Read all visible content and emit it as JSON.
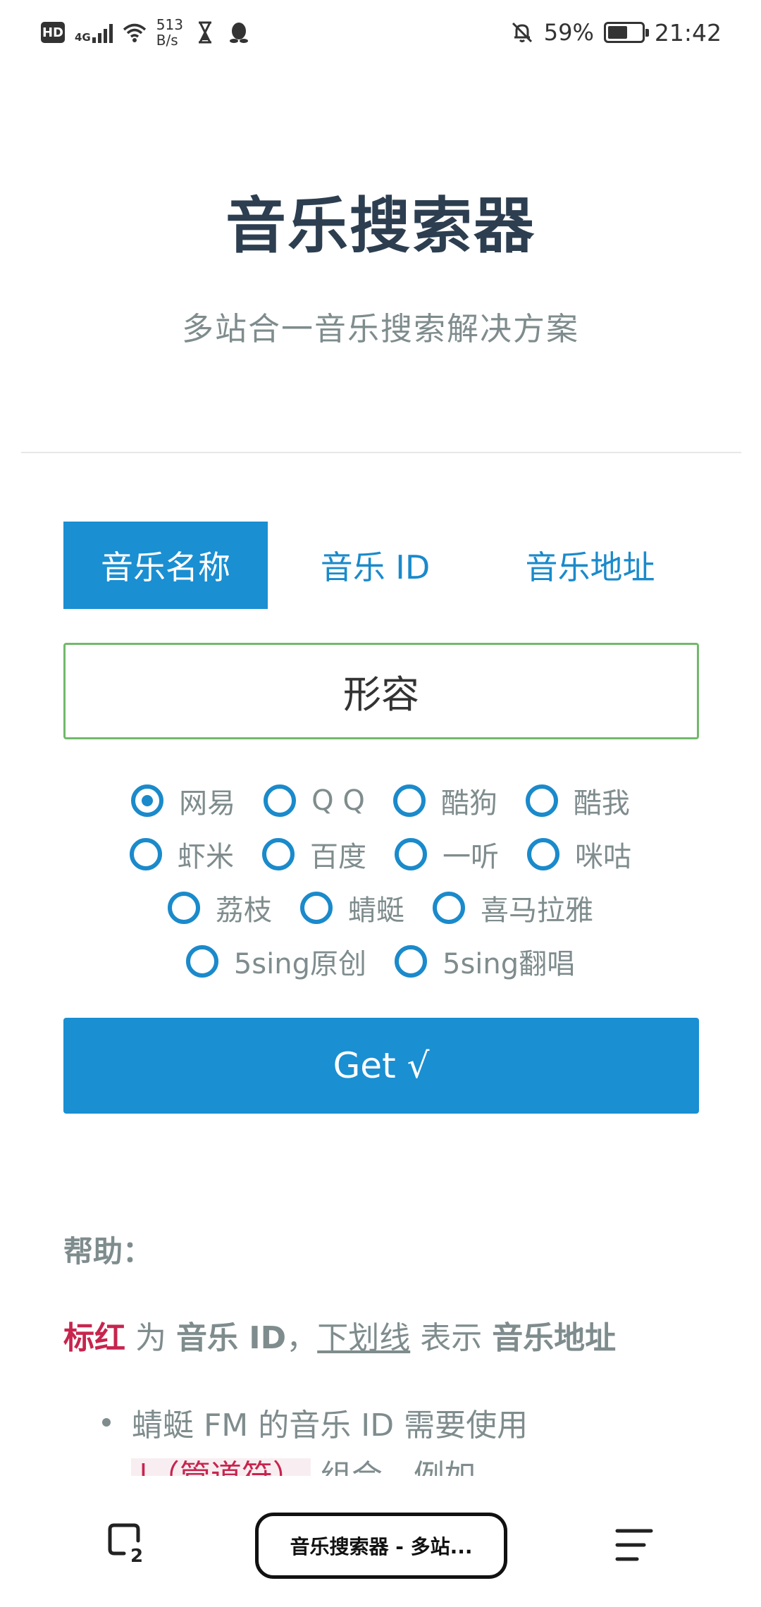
{
  "status_bar": {
    "hd_label": "HD",
    "network_label": "4G",
    "speed_value": "513",
    "speed_unit": "B/s",
    "battery_percent": "59%",
    "battery_level": 0.59,
    "time": "21:42",
    "icons": [
      "hd-icon",
      "signal-icon",
      "wifi-icon",
      "hourglass-icon",
      "qq-icon",
      "mute-bell-icon",
      "battery-icon"
    ]
  },
  "header": {
    "title": "音乐搜索器",
    "subtitle": "多站合一音乐搜索解决方案"
  },
  "tabs": [
    {
      "label": "音乐名称",
      "active": true
    },
    {
      "label": "音乐 ID",
      "active": false
    },
    {
      "label": "音乐地址",
      "active": false
    }
  ],
  "search": {
    "value": "形容",
    "placeholder": ""
  },
  "sources": {
    "rows": [
      [
        {
          "label": "网易",
          "selected": true
        },
        {
          "label": "Q Q",
          "selected": false
        },
        {
          "label": "酷狗",
          "selected": false
        },
        {
          "label": "酷我",
          "selected": false
        }
      ],
      [
        {
          "label": "虾米",
          "selected": false
        },
        {
          "label": "百度",
          "selected": false
        },
        {
          "label": "一听",
          "selected": false
        },
        {
          "label": "咪咕",
          "selected": false
        }
      ],
      [
        {
          "label": "荔枝",
          "selected": false
        },
        {
          "label": "蜻蜓",
          "selected": false
        },
        {
          "label": "喜马拉雅",
          "selected": false
        }
      ],
      [
        {
          "label": "5sing原创",
          "selected": false
        },
        {
          "label": "5sing翻唱",
          "selected": false
        }
      ]
    ]
  },
  "get_button": {
    "label": "Get √"
  },
  "help": {
    "title": "帮助：",
    "line_red": "标红",
    "line_text1": " 为 ",
    "line_bold1": "音乐 ID",
    "line_text2": "，",
    "line_underline": "下划线",
    "line_text3": " 表示 ",
    "line_bold2": "音乐地址",
    "bullet_text": "蜻蜓 FM 的音乐 ID 需要使用",
    "bullet_code": "|（管道符）",
    "bullet_cont": " 组合，例如"
  },
  "bottom_bar": {
    "tab_count": "2",
    "page_title": "音乐搜索器 - 多站..."
  },
  "colors": {
    "accent": "#1a8fd2",
    "input_border": "#72b96b",
    "title": "#2c3e50",
    "muted": "#7f8c8d",
    "red_code": "#c7254e"
  }
}
